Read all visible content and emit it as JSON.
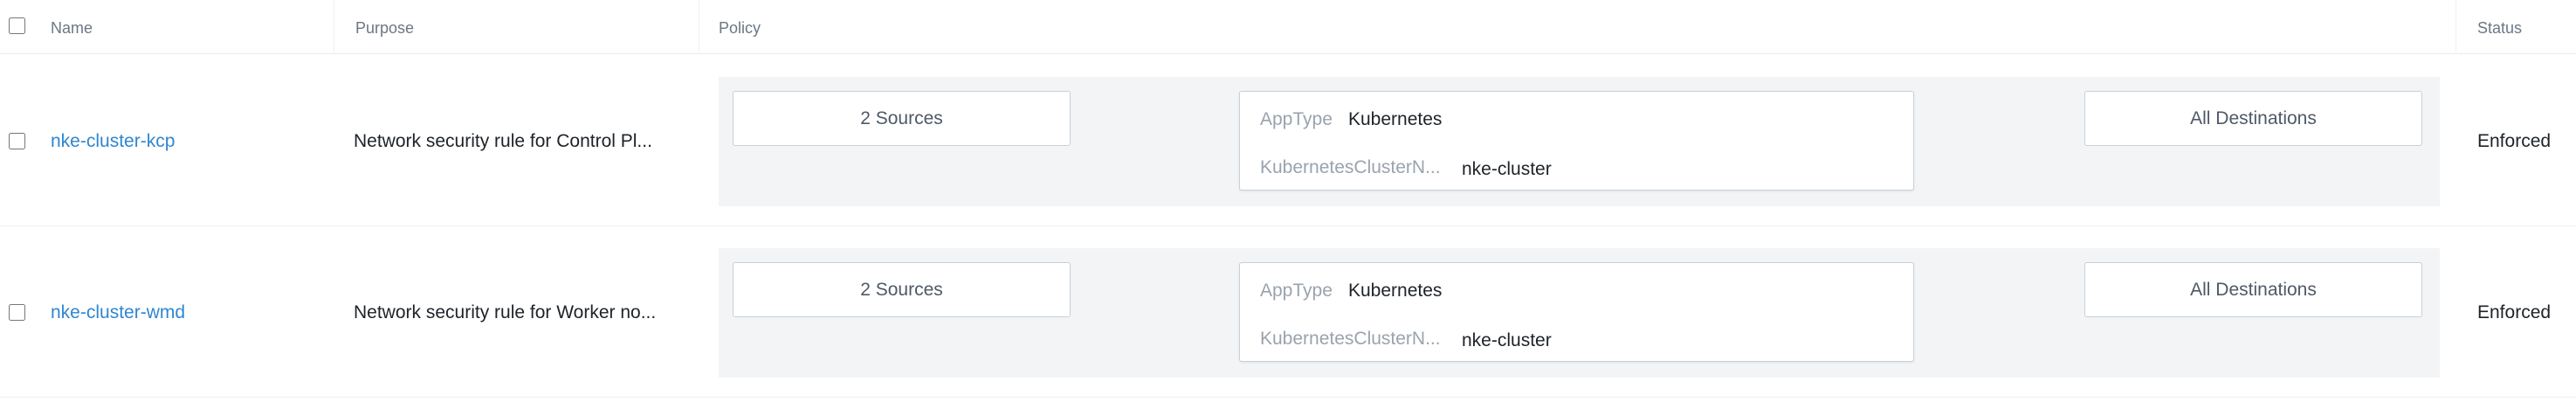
{
  "header": {
    "name": "Name",
    "purpose": "Purpose",
    "policy": "Policy",
    "status": "Status"
  },
  "rows": [
    {
      "name": "nke-cluster-kcp",
      "purpose": "Network security rule for Control Pl...",
      "sources": "2 Sources",
      "app_type_key": "AppType",
      "app_type_value": "Kubernetes",
      "cluster_key": "KubernetesClusterN...",
      "cluster_value": "nke-cluster",
      "destinations": "All Destinations",
      "status": "Enforced"
    },
    {
      "name": "nke-cluster-wmd",
      "purpose": "Network security rule for Worker no...",
      "sources": "2 Sources",
      "app_type_key": "AppType",
      "app_type_value": "Kubernetes",
      "cluster_key": "KubernetesClusterN...",
      "cluster_value": "nke-cluster",
      "destinations": "All Destinations",
      "status": "Enforced"
    }
  ],
  "colors": {
    "link": "#2e86d1",
    "band": "#f2f4f6",
    "border": "#c8d0d8"
  }
}
